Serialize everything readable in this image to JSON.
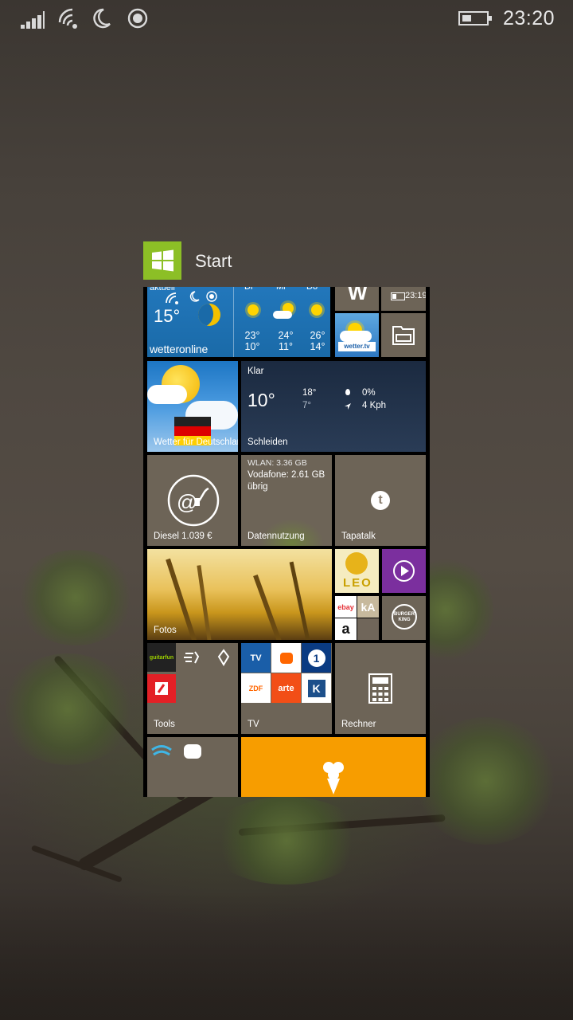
{
  "status_bar": {
    "time": "23:20"
  },
  "start": {
    "title": "Start"
  },
  "tiles": {
    "wetter_online": {
      "top_label": "aktuell",
      "current_temp": "15°",
      "brand": "wetteronline",
      "days": [
        "Di",
        "Mi",
        "Do"
      ],
      "forecast": [
        {
          "high": "23°",
          "low": "10°"
        },
        {
          "high": "24°",
          "low": "11°"
        },
        {
          "high": "26°",
          "low": "14°"
        }
      ]
    },
    "w_tile": {
      "letter": "W"
    },
    "battery_tile": {
      "time": "23:19"
    },
    "wetter_tv": {
      "badge": "wetter.tv"
    },
    "wetter_deutschland": {
      "label": "Wetter für Deutschland"
    },
    "weather": {
      "condition": "Klar",
      "temp": "10°",
      "high": "18°",
      "low": "7°",
      "precip": "0%",
      "wind": "4 Kph",
      "location": "Schleiden"
    },
    "diesel": {
      "label": "Diesel 1.039 €"
    },
    "data_usage": {
      "wlan": "WLAN: 3.36 GB",
      "vodafone": "Vodafone: 2.61 GB übrig",
      "label": "Datennutzung"
    },
    "tapatalk": {
      "label": "Tapatalk"
    },
    "fotos": {
      "label": "Fotos"
    },
    "leo": {
      "text": "LEO"
    },
    "shop": {
      "ebay": "ebay",
      "ka": "kA",
      "amazon": "a"
    },
    "burger_king": {
      "text": "BURGER KING"
    },
    "tools": {
      "label": "Tools",
      "guitar": "guitarfun"
    },
    "tv": {
      "label": "TV",
      "channels": [
        "TV",
        "",
        "1",
        "ZDF",
        "arte",
        "K"
      ]
    },
    "rechner": {
      "label": "Rechner"
    }
  }
}
